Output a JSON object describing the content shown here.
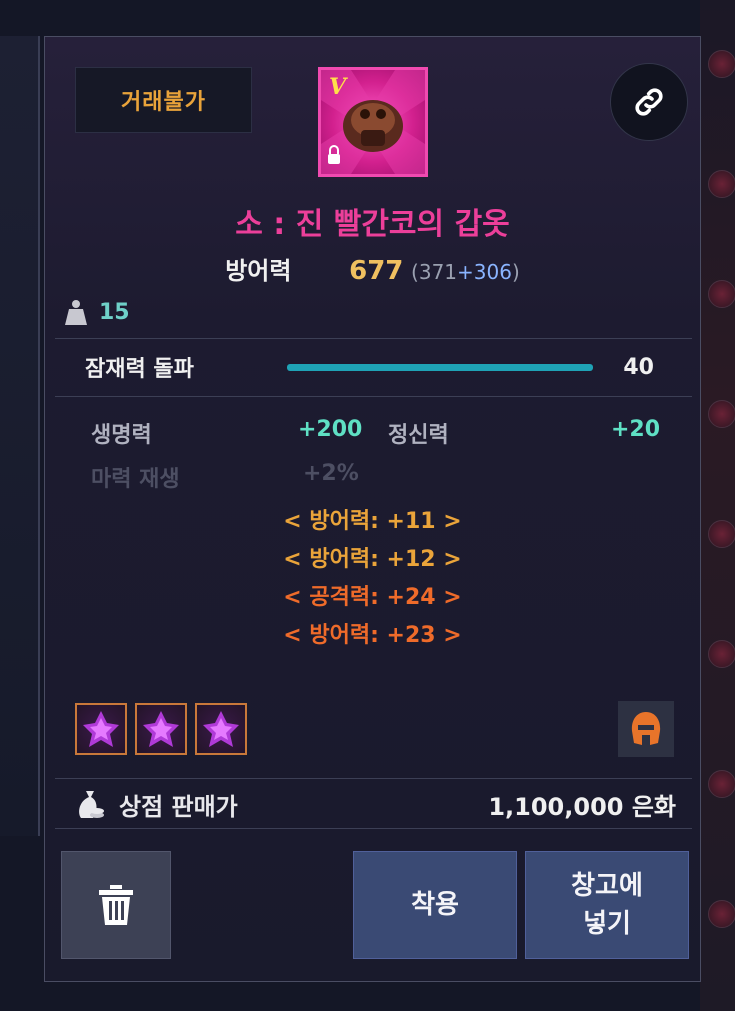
{
  "tooltip": {
    "trade_status": "거래불가",
    "item_name": "소 : 진 빨간코의 갑옷",
    "defense": {
      "label": "방어력",
      "value": "677",
      "paren_open": "(",
      "base": "371",
      "bonus": "+306",
      "paren_close": ")"
    },
    "weight": "15",
    "potential": {
      "label": "잠재력 돌파",
      "value": "40",
      "fill_fraction": 1.0
    },
    "stats": [
      {
        "label": "생명력",
        "value": "+200"
      },
      {
        "label": "정신력",
        "value": "+20"
      },
      {
        "label": "마력 재생",
        "value": "+2%"
      }
    ],
    "line_effects": [
      {
        "text": "< 방어력: +11 >",
        "color": "#eaa43a"
      },
      {
        "text": "< 방어력: +12 >",
        "color": "#eaa43a"
      },
      {
        "text": "< 공격력: +24 >",
        "color": "#ef6b2a"
      },
      {
        "text": "< 방어력: +23 >",
        "color": "#ef6b2a"
      }
    ],
    "gems": [
      "gem-icon",
      "gem-icon",
      "gem-icon"
    ],
    "class_icon": "helmet-icon",
    "shop_price": {
      "label": "상점 판매가",
      "value": "1,100,000 은화"
    },
    "buttons": {
      "delete_icon": "trash-icon",
      "equip": "착용",
      "store": "창고에\n넣기"
    },
    "colors": {
      "item_name": "#ec3f9a",
      "trade_badge": "#e9a33a",
      "stat_value": "#5fe0c4",
      "potential_bar": "#1fa3b6"
    }
  }
}
